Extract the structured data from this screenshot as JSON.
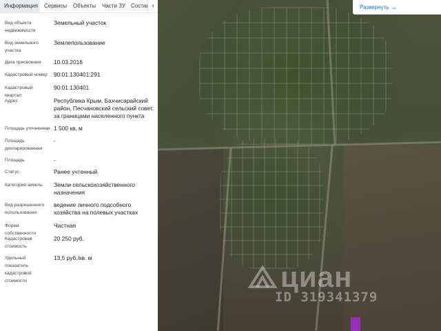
{
  "tabs": [
    {
      "label": "Информация",
      "active": true
    },
    {
      "label": "Сервисы",
      "active": false
    },
    {
      "label": "Объекты",
      "active": false
    },
    {
      "label": "Части ЗУ",
      "active": false
    },
    {
      "label": "Состав",
      "active": false
    }
  ],
  "tabs_more": "›",
  "rows": [
    {
      "label": "Вид объекта недвижимости",
      "value": "Земельный участок"
    },
    {
      "label": "Вид земельного участка",
      "value": "Землепользование"
    },
    {
      "label": "Дата присвоения",
      "value": "10.03.2016"
    },
    {
      "label": "Кадастровый номер",
      "value": "90:01:130401:291"
    },
    {
      "label": "Кадастровый квартал",
      "value": "90:01:130401"
    },
    {
      "label": "Адрес",
      "value": "Республика Крым, Бахчисарайский район, Песчановский сельский совет, за границами населенного пункта"
    },
    {
      "label": "Площадь уточненная",
      "value": "1 500 кв. м"
    },
    {
      "label": "Площадь декларированная",
      "value": "-"
    },
    {
      "label": "Площадь",
      "value": "-"
    },
    {
      "label": "Статус",
      "value": "Ранее учтенный"
    },
    {
      "label": "Категория земель",
      "value": "Земли сельскохозяйственного назначения"
    },
    {
      "label": "Вид разрешенного использования",
      "value": "ведение личного подсобного хозяйства на полевых участках"
    },
    {
      "label": "Форма собственности",
      "value": "Частная"
    },
    {
      "label": "Кадастровая стоимость",
      "value": "20 250 руб."
    },
    {
      "label": "Удельный показатель кадастровой стоимости",
      "value": "13,5 руб./кв. м"
    }
  ],
  "map": {
    "expand_label": "Развернуть",
    "expand_icon": "chevron-down-icon",
    "watermark_brand": "циан",
    "watermark_id": "ID 319341379",
    "marker_color": "#a02cc8"
  },
  "colors": {
    "link": "#1a73d9",
    "active_tab_bg": "#e9eef3"
  }
}
